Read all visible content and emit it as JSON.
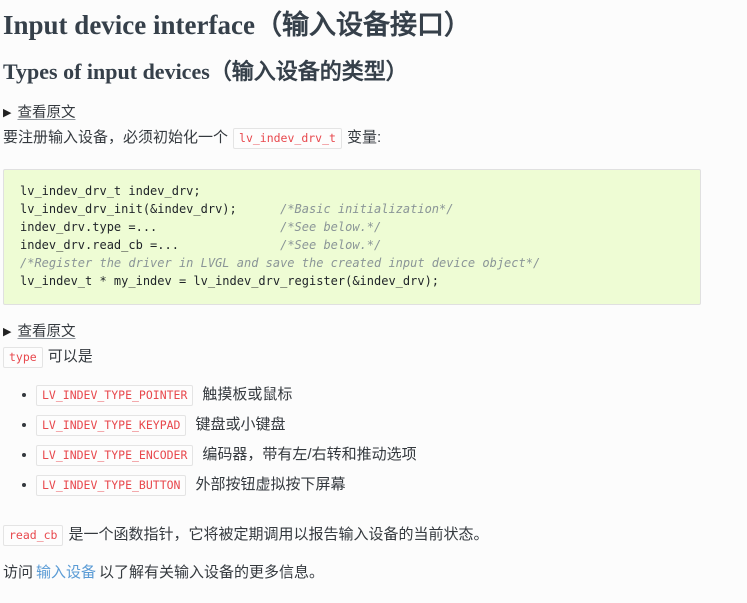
{
  "page": {
    "background": "#fcfcfc",
    "text_color": "#34393e",
    "accent_code_color": "#e8484d",
    "link_color": "#5a9bd5",
    "codeblock_bg": "#eefcd4"
  },
  "headings": {
    "h1": "Input device interface（输入设备接口）",
    "h2": "Types of input devices（输入设备的类型）"
  },
  "details_one": {
    "triangle": "▶",
    "summary": "查看原文"
  },
  "intro_paragraph": {
    "before": "要注册输入设备，必须初始化一个",
    "code": "lv_indev_drv_t",
    "after": "变量:"
  },
  "code_block": {
    "lines": [
      {
        "code": "lv_indev_drv_t indev_drv;",
        "comment": ""
      },
      {
        "code": "lv_indev_drv_init(&indev_drv);",
        "comment": "/*Basic initialization*/"
      },
      {
        "code": "indev_drv.type =...",
        "comment": "/*See below.*/"
      },
      {
        "code": "indev_drv.read_cb =...",
        "comment": "/*See below.*/"
      },
      {
        "code": "",
        "comment": "/*Register the driver in LVGL and save the created input device object*/"
      },
      {
        "code": "lv_indev_t * my_indev = lv_indev_drv_register(&indev_drv);",
        "comment": ""
      }
    ],
    "raw": "lv_indev_drv_t indev_drv;\nlv_indev_drv_init(&indev_drv);      /*Basic initialization*/\nindev_drv.type =...                 /*See below.*/\nindev_drv.read_cb =...              /*See below.*/\n/*Register the driver in LVGL and save the created input device object*/\nlv_indev_t * my_indev = lv_indev_drv_register(&indev_drv);"
  },
  "details_two": {
    "triangle": "▶",
    "summary": "查看原文"
  },
  "type_intro": {
    "code": "type",
    "after": "可以是"
  },
  "type_list": [
    {
      "code": "LV_INDEV_TYPE_POINTER",
      "label": "触摸板或鼠标"
    },
    {
      "code": "LV_INDEV_TYPE_KEYPAD",
      "label": "键盘或小键盘"
    },
    {
      "code": "LV_INDEV_TYPE_ENCODER",
      "label": "编码器，带有左/右转和推动选项"
    },
    {
      "code": "LV_INDEV_TYPE_BUTTON",
      "label": "外部按钮虚拟按下屏幕"
    }
  ],
  "read_cb_paragraph": {
    "code": "read_cb",
    "after": "是一个函数指针，它将被定期调用以报告输入设备的当前状态。"
  },
  "visit_paragraph": {
    "before": "访问",
    "link": "输入设备",
    "after": "以了解有关输入设备的更多信息。"
  }
}
